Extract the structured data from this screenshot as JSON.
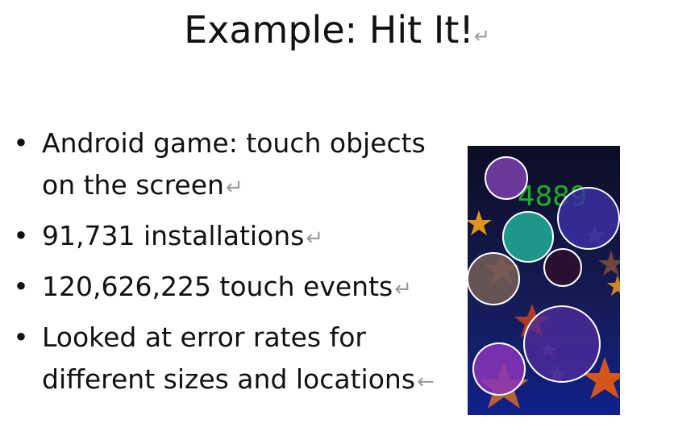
{
  "slide": {
    "title": "Example: Hit It!",
    "title_mark": "↵",
    "bullets": [
      {
        "text": "Android game: touch objects on the screen",
        "mark": "↵"
      },
      {
        "text": "91,731 installations",
        "mark": "↵"
      },
      {
        "text": "120,626,225 touch events",
        "mark": "↵"
      },
      {
        "text": "Looked at error rates for different sizes and locations",
        "mark": "←"
      }
    ]
  },
  "game": {
    "score": "4889",
    "background": [
      "#0c0d24",
      "#0f1a7a"
    ],
    "score_color": "#1fae2a",
    "colors": {
      "purple": "#7b3fae",
      "teal": "#1f9e8e",
      "blue": "#3a2fa0",
      "dark": "#2a1030",
      "brown": "#6f5a55",
      "violet": "#4e2a9a",
      "magenta": "#8a34b8",
      "star_orange": "#e3921c",
      "star_red": "#c8421c",
      "star_brown": "#7a4a3a"
    }
  }
}
